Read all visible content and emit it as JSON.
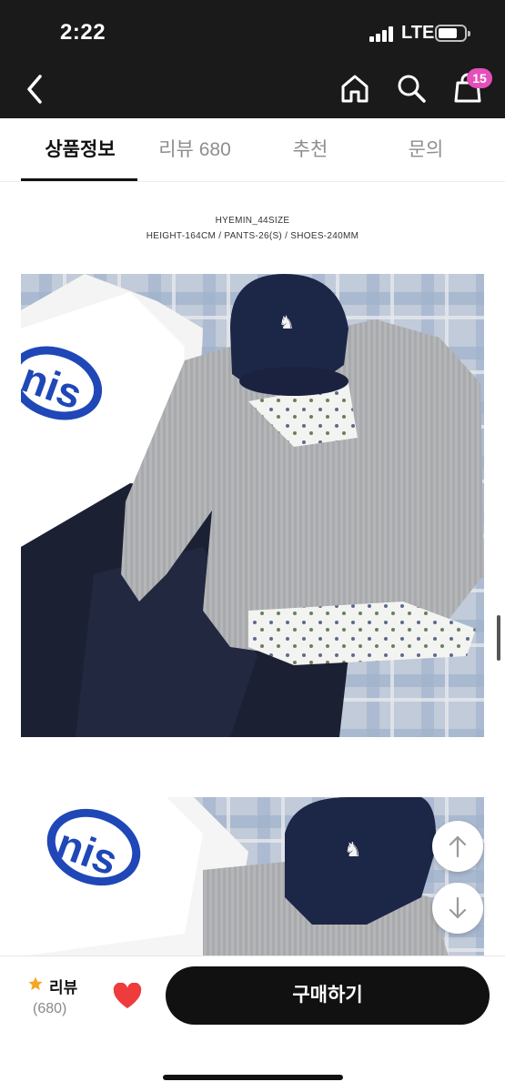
{
  "status_bar": {
    "time": "2:22",
    "network": "LTE",
    "battery_level": 0.75
  },
  "nav": {
    "back_icon": "chevron-left-icon",
    "home_icon": "home-icon",
    "search_icon": "search-icon",
    "bag_icon": "shopping-bag-icon",
    "bag_badge": "15",
    "badge_color": "#e64fb9"
  },
  "tabs": [
    {
      "label": "상품정보",
      "active": true
    },
    {
      "label": "리뷰 680",
      "active": false
    },
    {
      "label": "추천",
      "active": false
    },
    {
      "label": "문의",
      "active": false
    }
  ],
  "size_info": {
    "line1": "HYEMIN_44SIZE",
    "line2": "HEIGHT-164CM / PANTS-26(S) / SHOES-240MM"
  },
  "photos": [
    {
      "logo_text": "nis"
    },
    {
      "logo_text": "nis"
    }
  ],
  "floating": {
    "up_icon": "arrow-up-icon",
    "down_icon": "arrow-down-icon"
  },
  "bottom_bar": {
    "review_label": "리뷰",
    "review_count": "(680)",
    "star_icon": "star-icon",
    "heart_icon": "heart-icon",
    "buy_label": "구매하기",
    "heart_color": "#ee3b3b",
    "star_color": "#f5a623"
  }
}
